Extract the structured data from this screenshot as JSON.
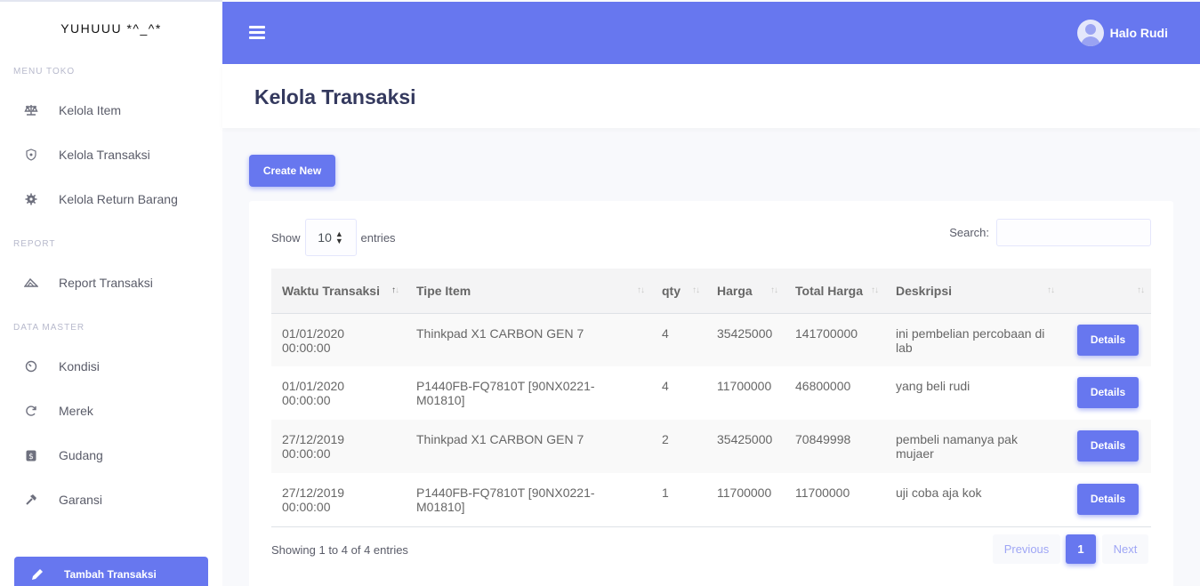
{
  "brand": "YUHUUU *^_^*",
  "sidebar": {
    "sections": [
      {
        "title": "MENU TOKO",
        "items": [
          {
            "label": "Kelola Item",
            "icon": "balance-scale-icon"
          },
          {
            "label": "Kelola Transaksi",
            "icon": "shield-icon"
          },
          {
            "label": "Kelola Return Barang",
            "icon": "cog-icon"
          }
        ]
      },
      {
        "title": "REPORT",
        "items": [
          {
            "label": "Report Transaksi",
            "icon": "ruler-icon"
          }
        ]
      },
      {
        "title": "DATA MASTER",
        "items": [
          {
            "label": "Kondisi",
            "icon": "gauge-icon"
          },
          {
            "label": "Merek",
            "icon": "refresh-icon"
          },
          {
            "label": "Gudang",
            "icon": "dollar-box-icon"
          },
          {
            "label": "Garansi",
            "icon": "hammer-icon"
          }
        ]
      }
    ],
    "cta_label": "Tambah Transaksi"
  },
  "topbar": {
    "user_name": "Halo Rudi"
  },
  "page": {
    "title": "Kelola Transaksi",
    "create_label": "Create New"
  },
  "table": {
    "show_label": "Show",
    "entries_value": "10",
    "entries_label": "entries",
    "search_label": "Search:",
    "search_value": "",
    "columns": [
      "Waktu Transaksi",
      "Tipe Item",
      "qty",
      "Harga",
      "Total Harga",
      "Deskripsi",
      ""
    ],
    "rows": [
      [
        "01/01/2020 00:00:00",
        "Thinkpad X1 CARBON GEN 7",
        "4",
        "35425000",
        "141700000",
        "ini pembelian percobaan di lab",
        "Details"
      ],
      [
        "01/01/2020 00:00:00",
        "P1440FB-FQ7810T [90NX0221-M01810]",
        "4",
        "11700000",
        "46800000",
        "yang beli rudi",
        "Details"
      ],
      [
        "27/12/2019 00:00:00",
        "Thinkpad X1 CARBON GEN 7",
        "2",
        "35425000",
        "70849998",
        "pembeli namanya pak mujaer",
        "Details"
      ],
      [
        "27/12/2019 00:00:00",
        "P1440FB-FQ7810T [90NX0221-M01810]",
        "1",
        "11700000",
        "11700000",
        "uji coba aja kok",
        "Details"
      ]
    ],
    "info": "Showing 1 to 4 of 4 entries",
    "pagination": {
      "previous": "Previous",
      "current": "1",
      "next": "Next"
    }
  },
  "colors": {
    "primary": "#6777ef",
    "sidebar_bg": "#ffffff",
    "body_bg": "#f8f9fc"
  }
}
